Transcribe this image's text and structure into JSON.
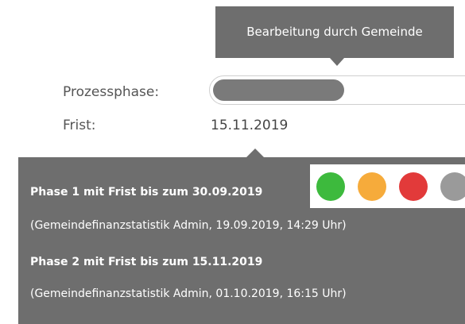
{
  "tooltip": {
    "text": "Bearbeitung durch Gemeinde"
  },
  "process": {
    "phase_label": "Prozessphase:",
    "deadline_label": "Frist:",
    "deadline_value": "15.11.2019",
    "progress_fraction": 0.5
  },
  "history": [
    {
      "title": "Phase 1 mit Frist bis zum 30.09.2019",
      "meta": "(Gemeindefinanzstatistik Admin, 19.09.2019, 14:29 Uhr)"
    },
    {
      "title": "Phase 2 mit Frist bis zum 15.11.2019",
      "meta": "(Gemeindefinanzstatistik Admin, 01.10.2019, 16:15 Uhr)"
    }
  ],
  "status_colors": {
    "green": "#3dba3d",
    "orange": "#f6ab3b",
    "red": "#e23a3a",
    "grey": "#9a9a9a"
  },
  "theme": {
    "panel_bg": "#6e6e6e",
    "progress_fill": "#7a7a7a"
  }
}
